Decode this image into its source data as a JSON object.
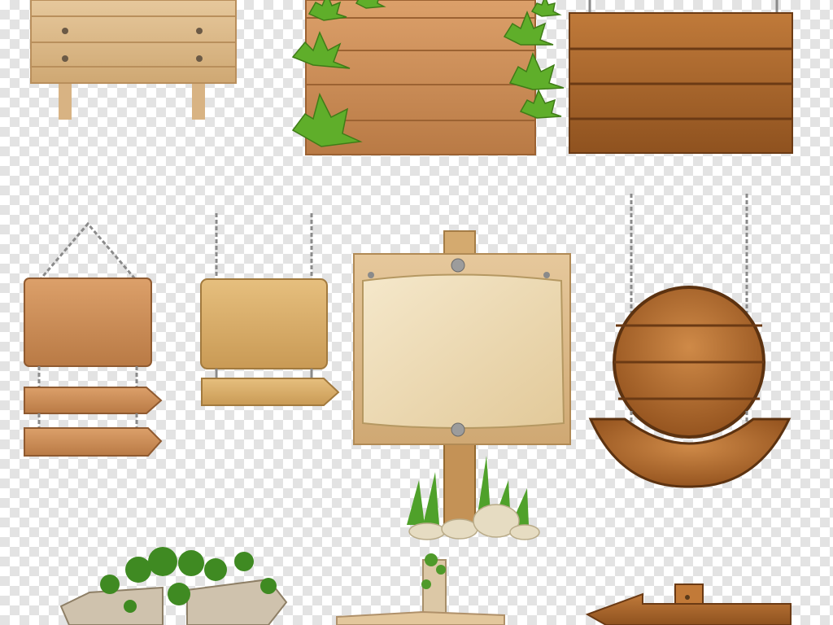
{
  "colors": {
    "checker_light": "#ffffff",
    "checker_dark": "#e3e3e3",
    "pale_wood": "#dcb98a",
    "warm_wood": "#c98b56",
    "dark_wood": "#a9652f",
    "light_board": "#d9ad6b",
    "parchment": "#f0dfbd",
    "leaf_green": "#5fae2a",
    "chain": "#8a8a8a",
    "rock": "#e6dcc2"
  },
  "icons": [
    "plain-signpost-icon",
    "ivy-wood-sign-icon",
    "hanging-dark-plank-sign-icon",
    "chained-arrow-sign-icon",
    "chained-yellow-arrow-sign-icon",
    "parchment-signpost-icon",
    "round-hanging-sign-icon",
    "ivy-covered-arrow-signs-icon",
    "post-with-arrow-sign-icon",
    "left-arrow-sign-icon"
  ]
}
